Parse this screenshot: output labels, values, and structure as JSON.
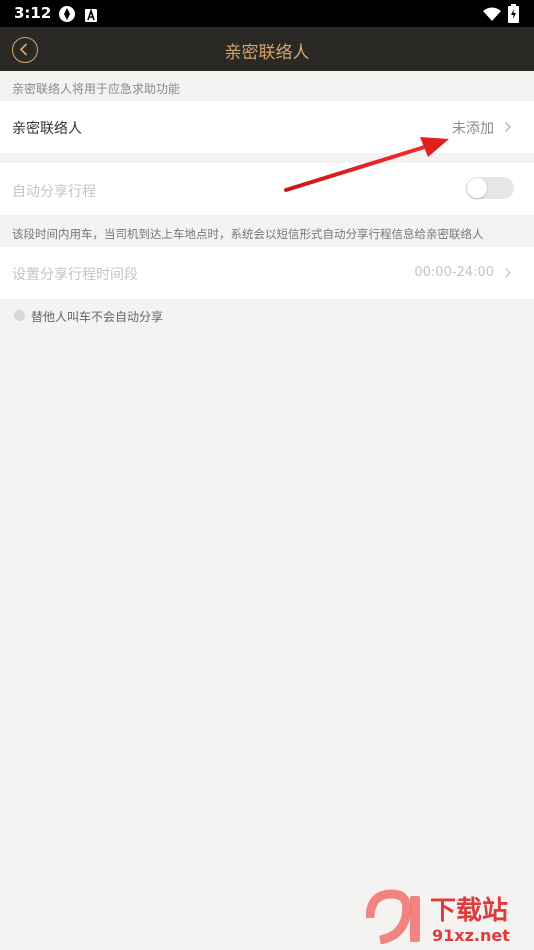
{
  "status_bar": {
    "time": "3:12",
    "icons": [
      "aperture-icon",
      "a-box-icon",
      "wifi-icon",
      "battery-icon"
    ]
  },
  "header": {
    "title": "亲密联络人",
    "back_icon": "back-circle-icon"
  },
  "intro_hint": "亲密联络人将用于应急求助功能",
  "contact_row": {
    "label": "亲密联络人",
    "value": "未添加"
  },
  "share_row": {
    "label": "自动分享行程",
    "enabled": false
  },
  "share_hint": "该段时间内用车，当司机到达上车地点时，系统会以短信形式自动分享行程信息给亲密联络人",
  "time_row": {
    "label": "设置分享行程时间段",
    "value": "00:00-24:00"
  },
  "note": "替他人叫车不会自动分享",
  "watermark": {
    "logo_text": "91",
    "name": "下载站",
    "url": "91xz.net"
  },
  "colors": {
    "accent": "#d3a56c",
    "nav_bg": "#2b2925",
    "page_bg": "#f4f3f2",
    "arrow": "#e02020"
  }
}
